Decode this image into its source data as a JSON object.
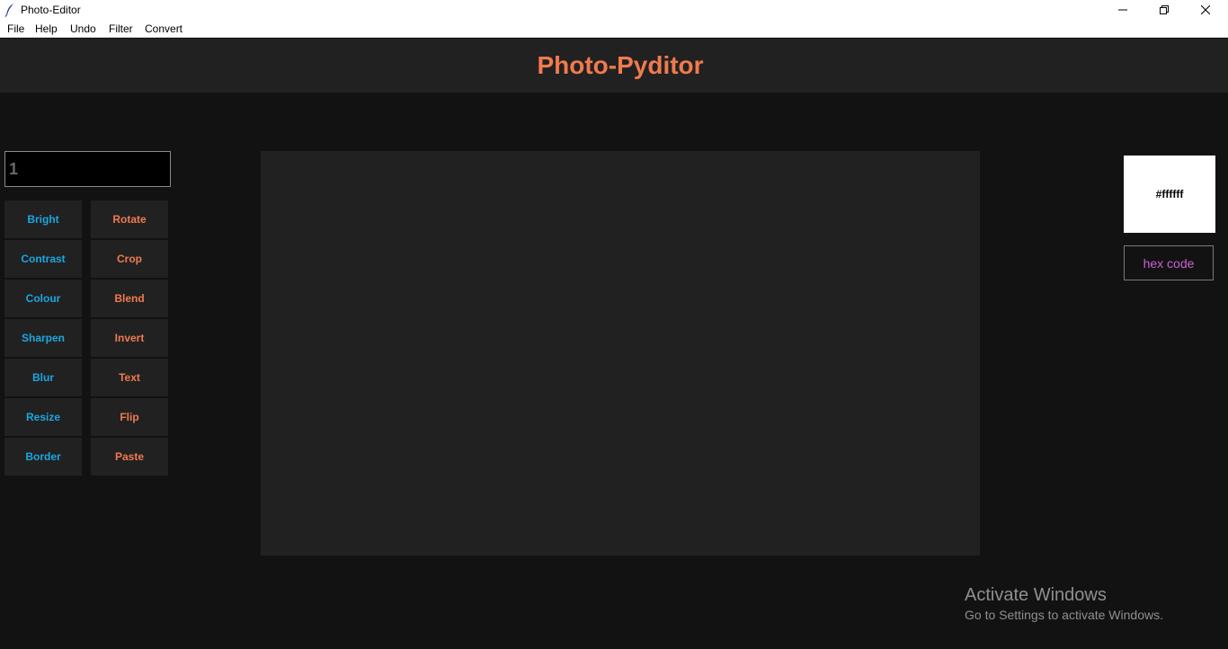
{
  "window": {
    "title": "Photo-Editor",
    "app_icon": "feather-icon",
    "controls": [
      "minimize-icon",
      "restore-icon",
      "close-icon"
    ]
  },
  "menu": {
    "items": [
      "File",
      "Help",
      "Undo",
      "Filter",
      "Convert"
    ]
  },
  "header": {
    "title": "Photo-Pyditor",
    "title_color": "#f07a4f"
  },
  "input": {
    "value": "1"
  },
  "tools": {
    "left": [
      "Bright",
      "Contrast",
      "Colour",
      "Sharpen",
      "Blur",
      "Resize",
      "Border"
    ],
    "right": [
      "Rotate",
      "Crop",
      "Blend",
      "Invert",
      "Text",
      "Flip",
      "Paste"
    ],
    "left_color": "#1aa7e0",
    "right_color": "#f07a4f"
  },
  "color_panel": {
    "swatch_value": "#ffffff",
    "hex_button_label": "hex code",
    "hex_button_color": "#c961d6"
  },
  "watermark": {
    "title": "Activate Windows",
    "subtitle": "Go to Settings to activate Windows."
  }
}
